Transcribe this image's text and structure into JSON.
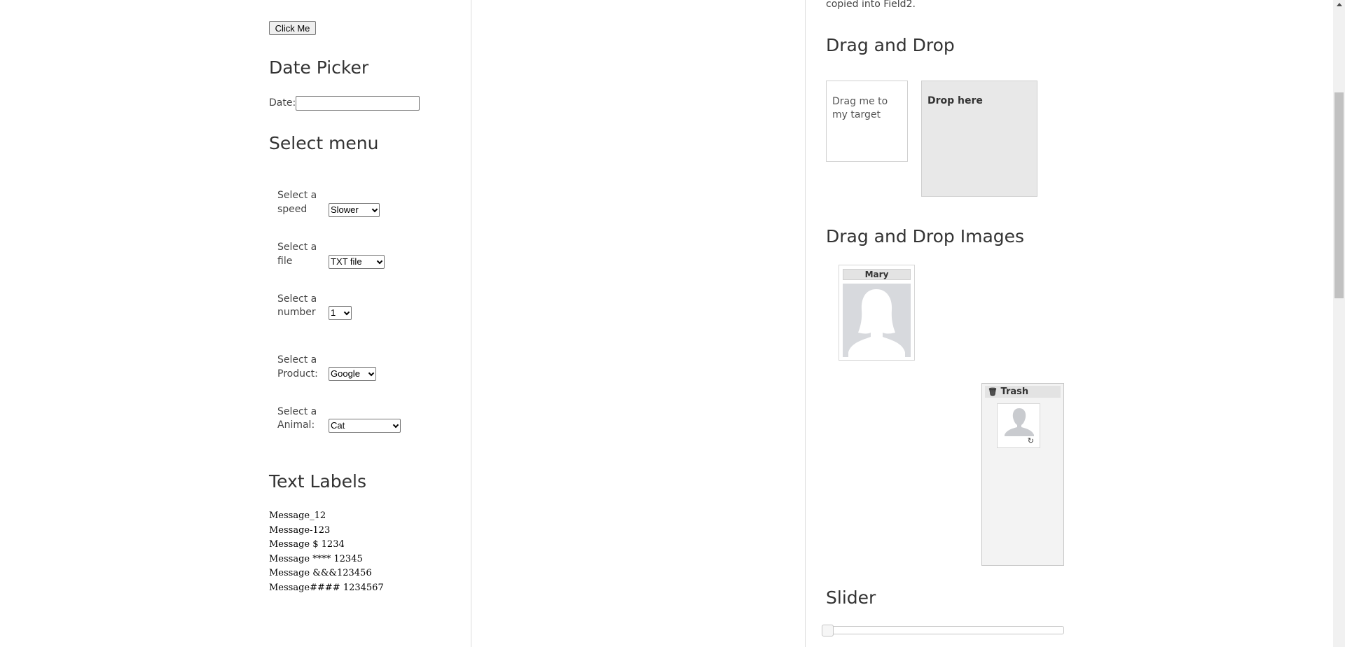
{
  "left": {
    "click_button_label": "Click Me",
    "date_picker": {
      "heading": "Date Picker",
      "label": "Date:",
      "value": ""
    },
    "select_menu": {
      "heading": "Select menu",
      "rows": [
        {
          "label_line1": "Select a",
          "label_line2": "speed",
          "value": "Slower"
        },
        {
          "label_line1": "Select a",
          "label_line2": "file",
          "value": "TXT file"
        },
        {
          "label_line1": "Select a",
          "label_line2": "number",
          "value": "1"
        },
        {
          "label_line1": "Select a",
          "label_line2": "Product:",
          "value": "Google"
        },
        {
          "label_line1": "Select a",
          "label_line2": "Animal:",
          "value": "Cat"
        }
      ]
    },
    "text_labels": {
      "heading": "Text Labels",
      "messages": [
        "Message_12",
        "Message-123",
        "Message $ 1234",
        "Message **** 12345",
        "Message &&&123456",
        "Message#### 1234567"
      ]
    }
  },
  "right": {
    "top_text": "copied into Field2.",
    "drag_drop": {
      "heading": "Drag and Drop",
      "draggable_text": "Drag me to my target",
      "droppable_text": "Drop here"
    },
    "drag_drop_images": {
      "heading": "Drag and Drop Images",
      "gallery_item_title": "Mary",
      "trash_title": "Trash"
    },
    "slider": {
      "heading": "Slider",
      "value_fraction": 0
    }
  },
  "colors": {
    "droppable_bg": "#e8e8e8",
    "trash_bg": "#f3f3f3",
    "avatar_bg": "#d7d9dd",
    "avatar_fg": "#ffffff"
  }
}
